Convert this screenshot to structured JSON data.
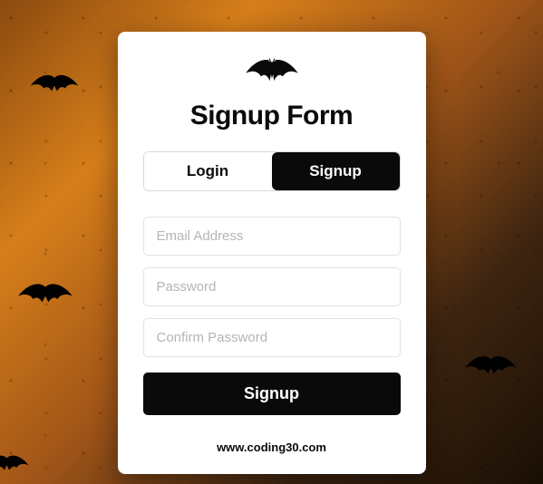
{
  "title": "Signup Form",
  "tabs": {
    "login": "Login",
    "signup": "Signup"
  },
  "fields": {
    "email": {
      "placeholder": "Email Address",
      "value": ""
    },
    "password": {
      "placeholder": "Password",
      "value": ""
    },
    "confirm": {
      "placeholder": "Confirm Password",
      "value": ""
    }
  },
  "submit_label": "Signup",
  "footer_text": "www.coding30.com",
  "colors": {
    "primary": "#0a0a0a",
    "card_bg": "#ffffff",
    "border": "#e2e2e2",
    "placeholder": "#b5b5b5"
  },
  "icons": {
    "logo": "bat-icon"
  }
}
